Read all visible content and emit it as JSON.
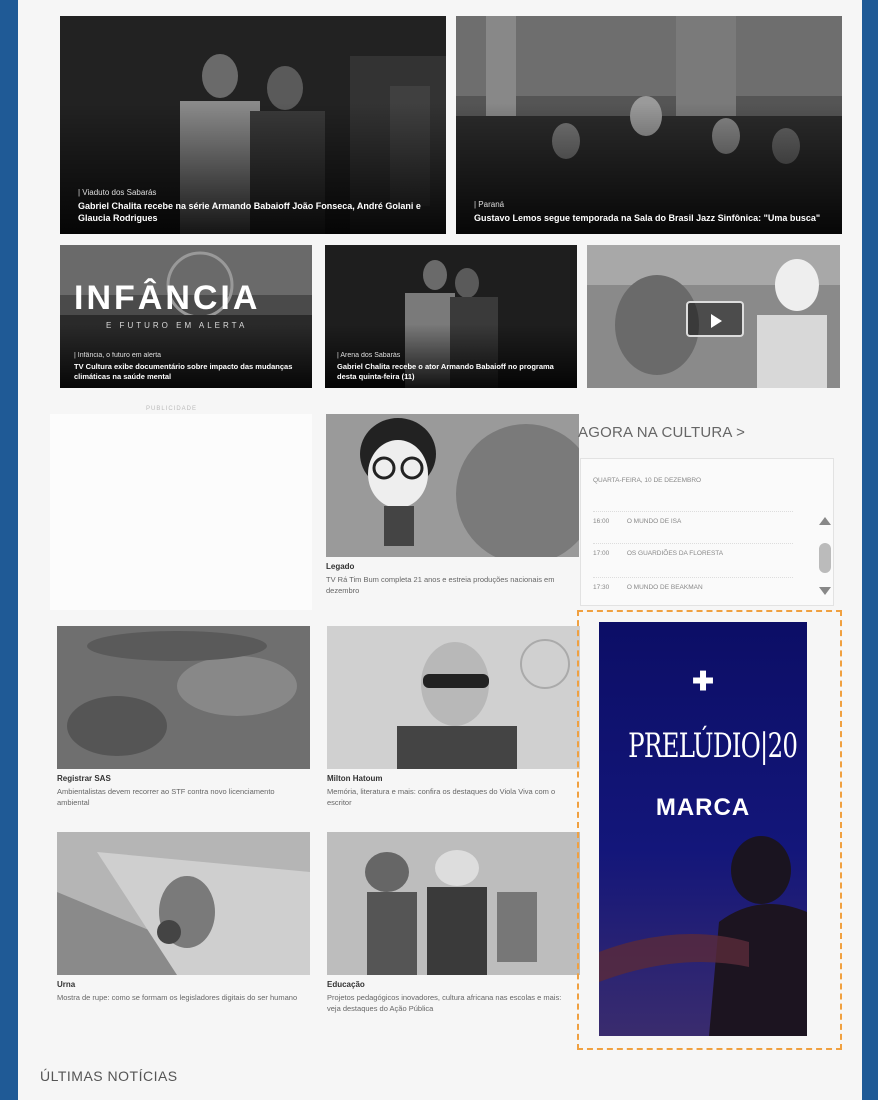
{
  "featured": [
    {
      "kicker": "| Viaduto dos Sabarás",
      "title": "Gabriel Chalita recebe na série Armando Babaioff João Fonseca, André Golani e Glaucia Rodrigues"
    },
    {
      "kicker": "| Paraná",
      "title": "Gustavo Lemos segue temporada na Sala do Brasil Jazz Sinfônica: \"Uma busca\""
    }
  ],
  "row2": [
    {
      "overlay_big": "INFÂNCIA",
      "overlay_small": "E FUTURO EM ALERTA",
      "kicker": "| Infância, o futuro em alerta",
      "title": "TV Cultura exibe documentário sobre impacto das mudanças climáticas na saúde mental"
    },
    {
      "kicker": "| Arena dos Sabarás",
      "title": "Gabriel Chalita recebe o ator Armando Babaioff no programa desta quinta-feira (11)"
    }
  ],
  "video": {
    "play_icon": "play-icon"
  },
  "ad_placeholder": {
    "label": "PUBLICIDADE"
  },
  "cards": [
    {
      "label": "Legado",
      "desc": "TV Rá Tim Bum completa 21 anos e estreia produções nacionais em dezembro"
    },
    {
      "label": "Registrar SAS",
      "desc": "Ambientalistas devem recorrer ao STF contra novo licenciamento ambiental"
    },
    {
      "label": "Milton Hatoum",
      "desc": "Memória, literatura e mais: confira os destaques do Viola Viva com o escritor"
    },
    {
      "label": "Urna",
      "desc": "Mostra de rupe: como se formam os legisladores digitais do ser humano"
    },
    {
      "label": "Educação",
      "desc": "Projetos pedagógicos inovadores, cultura africana nas escolas e mais: veja destaques do Ação Pública"
    }
  ],
  "agora": {
    "title": "AGORA NA CULTURA >",
    "date": "QUARTA-FEIRA, 10 DE DEZEMBRO",
    "schedule": [
      {
        "time": "16:00",
        "program": "O MUNDO DE ISA"
      },
      {
        "time": "17:00",
        "program": "OS GUARDIÕES DA FLORESTA"
      },
      {
        "time": "17:30",
        "program": "O MUNDO DE BEAKMAN"
      }
    ]
  },
  "ad": {
    "plus": "✚",
    "prelude": "PRELÚDIO|20",
    "marca": "MARCA"
  },
  "ultimas": "ÚLTIMAS NOTÍCIAS",
  "colors": {
    "background": "#1f5a96",
    "ad_border": "#f0a040",
    "ad_bg": "#12157a"
  }
}
